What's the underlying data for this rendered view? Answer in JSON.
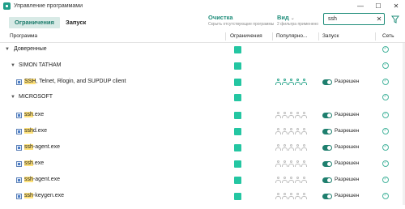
{
  "window": {
    "title": "Управление программами",
    "minimize": "—",
    "maximize": "☐",
    "close": "✕"
  },
  "toolbar": {
    "tab_restrictions": "Ограничения",
    "tab_launch": "Запуск",
    "clean_title": "Очистка",
    "clean_sub": "Скрыть отсутствующие программы",
    "view_title": "Вид",
    "view_sub": "2 фильтра применено",
    "search_value": "ssh",
    "clear_glyph": "✕"
  },
  "columns": {
    "program": "Программа",
    "restrictions": "Ограничения",
    "popularity": "Популярно...",
    "launch": "Запуск",
    "network": "Сеть"
  },
  "groups": {
    "trusted": {
      "label": "Доверенные"
    },
    "simon": {
      "label": "SIMON TATHAM"
    },
    "microsoft": {
      "label": "MICROSOFT"
    }
  },
  "programs": [
    {
      "hl": "SSH",
      "rest": ", Telnet, Rlogin, and SUPDUP client",
      "popularity": 5,
      "launch": "Разрешен"
    },
    {
      "hl": "ssh",
      "rest": ".exe",
      "popularity": 0,
      "launch": "Разрешен"
    },
    {
      "hl": "ssh",
      "rest": "d.exe",
      "popularity": 0,
      "launch": "Разрешен"
    },
    {
      "hl": "ssh",
      "rest": "-agent.exe",
      "popularity": 0,
      "launch": "Разрешен"
    },
    {
      "hl": "ssh",
      "rest": ".exe",
      "popularity": 0,
      "launch": "Разрешен"
    },
    {
      "hl": "ssh",
      "rest": "-agent.exe",
      "popularity": 0,
      "launch": "Разрешен"
    },
    {
      "hl": "ssh",
      "rest": "-keygen.exe",
      "popularity": 0,
      "launch": "Разрешен"
    }
  ],
  "colors": {
    "accent": "#1f8d7a",
    "restriction": "#24c6a2",
    "highlight": "#ffe27a"
  }
}
